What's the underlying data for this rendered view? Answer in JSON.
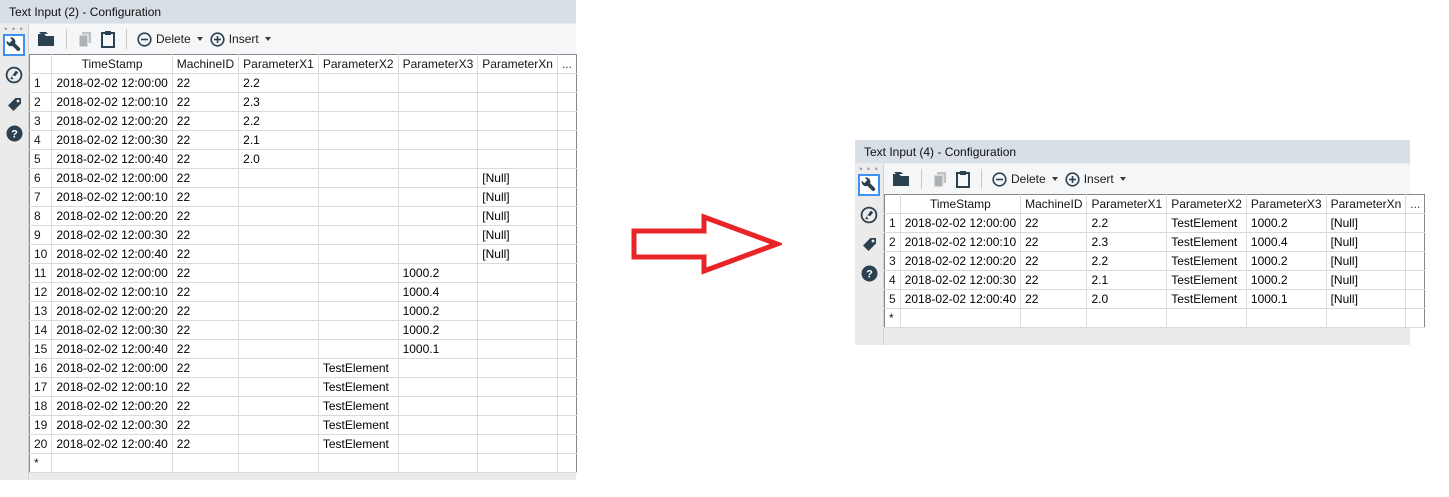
{
  "left": {
    "title": "Text Input (2) - Configuration",
    "toolbar": {
      "delete_label": "Delete",
      "insert_label": "Insert",
      "icons": [
        "open-folder",
        "copy",
        "paste",
        "circle-minus",
        "circle-plus"
      ]
    },
    "sidebar_icons": [
      "wrench",
      "annotation",
      "tag",
      "help"
    ],
    "grid": {
      "columns": [
        "TimeStamp",
        "MachineID",
        "ParameterX1",
        "ParameterX2",
        "ParameterX3",
        "ParameterXn"
      ],
      "more_label": "...",
      "new_row_marker": "*",
      "rows": [
        [
          "1",
          "2018-02-02 12:00:00",
          "22",
          "2.2",
          "",
          "",
          ""
        ],
        [
          "2",
          "2018-02-02 12:00:10",
          "22",
          "2.3",
          "",
          "",
          ""
        ],
        [
          "3",
          "2018-02-02 12:00:20",
          "22",
          "2.2",
          "",
          "",
          ""
        ],
        [
          "4",
          "2018-02-02 12:00:30",
          "22",
          "2.1",
          "",
          "",
          ""
        ],
        [
          "5",
          "2018-02-02 12:00:40",
          "22",
          "2.0",
          "",
          "",
          ""
        ],
        [
          "6",
          "2018-02-02 12:00:00",
          "22",
          "",
          "",
          "",
          "[Null]"
        ],
        [
          "7",
          "2018-02-02 12:00:10",
          "22",
          "",
          "",
          "",
          "[Null]"
        ],
        [
          "8",
          "2018-02-02 12:00:20",
          "22",
          "",
          "",
          "",
          "[Null]"
        ],
        [
          "9",
          "2018-02-02 12:00:30",
          "22",
          "",
          "",
          "",
          "[Null]"
        ],
        [
          "10",
          "2018-02-02 12:00:40",
          "22",
          "",
          "",
          "",
          "[Null]"
        ],
        [
          "11",
          "2018-02-02 12:00:00",
          "22",
          "",
          "",
          "1000.2",
          ""
        ],
        [
          "12",
          "2018-02-02 12:00:10",
          "22",
          "",
          "",
          "1000.4",
          ""
        ],
        [
          "13",
          "2018-02-02 12:00:20",
          "22",
          "",
          "",
          "1000.2",
          ""
        ],
        [
          "14",
          "2018-02-02 12:00:30",
          "22",
          "",
          "",
          "1000.2",
          ""
        ],
        [
          "15",
          "2018-02-02 12:00:40",
          "22",
          "",
          "",
          "1000.1",
          ""
        ],
        [
          "16",
          "2018-02-02 12:00:00",
          "22",
          "",
          "TestElement",
          "",
          ""
        ],
        [
          "17",
          "2018-02-02 12:00:10",
          "22",
          "",
          "TestElement",
          "",
          ""
        ],
        [
          "18",
          "2018-02-02 12:00:20",
          "22",
          "",
          "TestElement",
          "",
          ""
        ],
        [
          "19",
          "2018-02-02 12:00:30",
          "22",
          "",
          "TestElement",
          "",
          ""
        ],
        [
          "20",
          "2018-02-02 12:00:40",
          "22",
          "",
          "TestElement",
          "",
          ""
        ]
      ]
    }
  },
  "right": {
    "title": "Text Input (4) - Configuration",
    "toolbar": {
      "delete_label": "Delete",
      "insert_label": "Insert",
      "icons": [
        "open-folder",
        "copy",
        "paste",
        "circle-minus",
        "circle-plus"
      ]
    },
    "sidebar_icons": [
      "wrench",
      "annotation",
      "tag",
      "help"
    ],
    "grid": {
      "columns": [
        "TimeStamp",
        "MachineID",
        "ParameterX1",
        "ParameterX2",
        "ParameterX3",
        "ParameterXn"
      ],
      "more_label": "...",
      "new_row_marker": "*",
      "rows": [
        [
          "1",
          "2018-02-02 12:00:00",
          "22",
          "2.2",
          "TestElement",
          "1000.2",
          "[Null]"
        ],
        [
          "2",
          "2018-02-02 12:00:10",
          "22",
          "2.3",
          "TestElement",
          "1000.4",
          "[Null]"
        ],
        [
          "3",
          "2018-02-02 12:00:20",
          "22",
          "2.2",
          "TestElement",
          "1000.2",
          "[Null]"
        ],
        [
          "4",
          "2018-02-02 12:00:30",
          "22",
          "2.1",
          "TestElement",
          "1000.2",
          "[Null]"
        ],
        [
          "5",
          "2018-02-02 12:00:40",
          "22",
          "2.0",
          "TestElement",
          "1000.1",
          "[Null]"
        ]
      ]
    }
  },
  "arrow": {
    "color": "#e92427"
  }
}
